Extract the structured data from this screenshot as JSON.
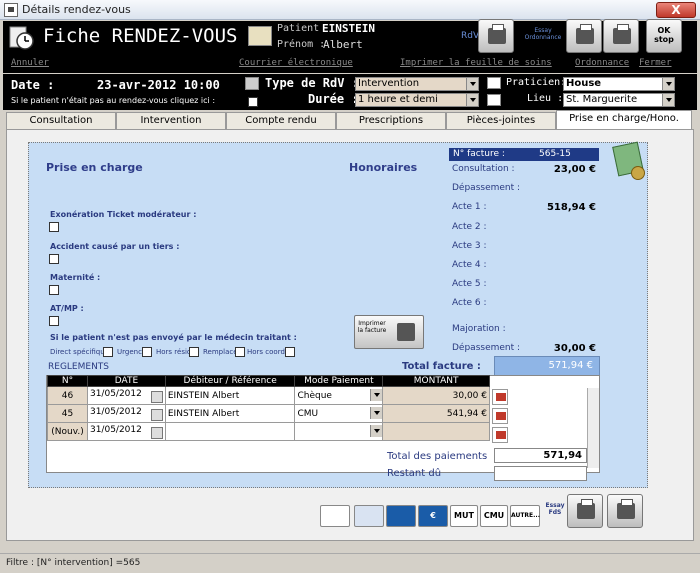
{
  "window": {
    "title": "Détails rendez-vous",
    "close_label": "X"
  },
  "header": {
    "title": "Fiche RENDEZ-VOUS",
    "patient_label": "Patient",
    "patient_name": "EINSTEIN",
    "prenom_label": "Prénom :",
    "prenom_value": "Albert",
    "rdv_label": "RdV",
    "essay_ordonnance": "Essay Ordonnance",
    "ok_stop": "OK stop"
  },
  "links": {
    "annuler": "Annuler",
    "courrier": "Courrier électronique",
    "imprimer": "Imprimer la feuille de soins",
    "ordonnance": "Ordonnance",
    "fermer": "Fermer"
  },
  "daterow": {
    "date_label": "Date :",
    "date_value": "23-avr-2012 10:00",
    "absent_text": "Si le patient n'était pas au rendez-vous cliquez ici :",
    "type_label": "Type de RdV :",
    "type_value": "Intervention",
    "duree_label": "Durée :",
    "duree_value": "1 heure et demi",
    "praticien_label": "Praticien:",
    "praticien_value": "House",
    "lieu_label": "Lieu :",
    "lieu_value": "St. Marguerite"
  },
  "tabs": [
    "Consultation",
    "Intervention",
    "Compte rendu",
    "Prescriptions",
    "Pièces-jointes",
    "Prise en charge/Hono."
  ],
  "prise": {
    "title": "Prise en charge",
    "exoneration": "Exonération Ticket modérateur :",
    "accident": "Accident causé par un tiers :",
    "maternite": "Maternité :",
    "atmp": "AT/MP :",
    "envoye": "Si le patient n'est pas envoyé par le médecin traitant :",
    "options": [
      "Direct spécifique",
      "Urgence",
      "Hors résid",
      "Remplace",
      "Hors coord"
    ]
  },
  "honoraires": {
    "title": "Honoraires",
    "facture_label": "N° facture :",
    "facture_value": "565-15",
    "rows": [
      {
        "label": "Consultation :",
        "value": "23,00 €"
      },
      {
        "label": "Dépassement :",
        "value": ""
      },
      {
        "label": "Acte 1 :",
        "value": "518,94 €"
      },
      {
        "label": "Acte 2 :",
        "value": ""
      },
      {
        "label": "Acte 3 :",
        "value": ""
      },
      {
        "label": "Acte 4 :",
        "value": ""
      },
      {
        "label": "Acte 5 :",
        "value": ""
      },
      {
        "label": "Acte 6 :",
        "value": ""
      },
      {
        "label": "Majoration :",
        "value": ""
      },
      {
        "label": "Dépassement :",
        "value": "30,00 €"
      }
    ],
    "imprimer_facture": "Imprimer la facture",
    "total_label": "Total facture :",
    "total_value": "571,94 €"
  },
  "reglements": {
    "title": "REGLEMENTS",
    "columns": [
      "N°",
      "DATE",
      "Débiteur / Référence",
      "Mode Paiement",
      "MONTANT"
    ],
    "rows": [
      {
        "num": "46",
        "date": "31/05/2012",
        "debiteur": "EINSTEIN  Albert",
        "mode": "Chèque",
        "montant": "30,00 €"
      },
      {
        "num": "45",
        "date": "31/05/2012",
        "debiteur": "EINSTEIN  Albert",
        "mode": "CMU",
        "montant": "541,94 €"
      },
      {
        "num": "(Nouv.)",
        "date": "31/05/2012",
        "debiteur": "",
        "mode": "",
        "montant": ""
      }
    ],
    "total_paiements_label": "Total des paiements",
    "total_paiements_value": "571,94",
    "restant_label": "Restant dû",
    "restant_value": ""
  },
  "paybuttons": {
    "mut": "MUT",
    "cmu": "CMU",
    "autre": "AUTRE...",
    "essay_fds": "Essay FdS"
  },
  "status": "Filtre :  [N° intervention] =565"
}
